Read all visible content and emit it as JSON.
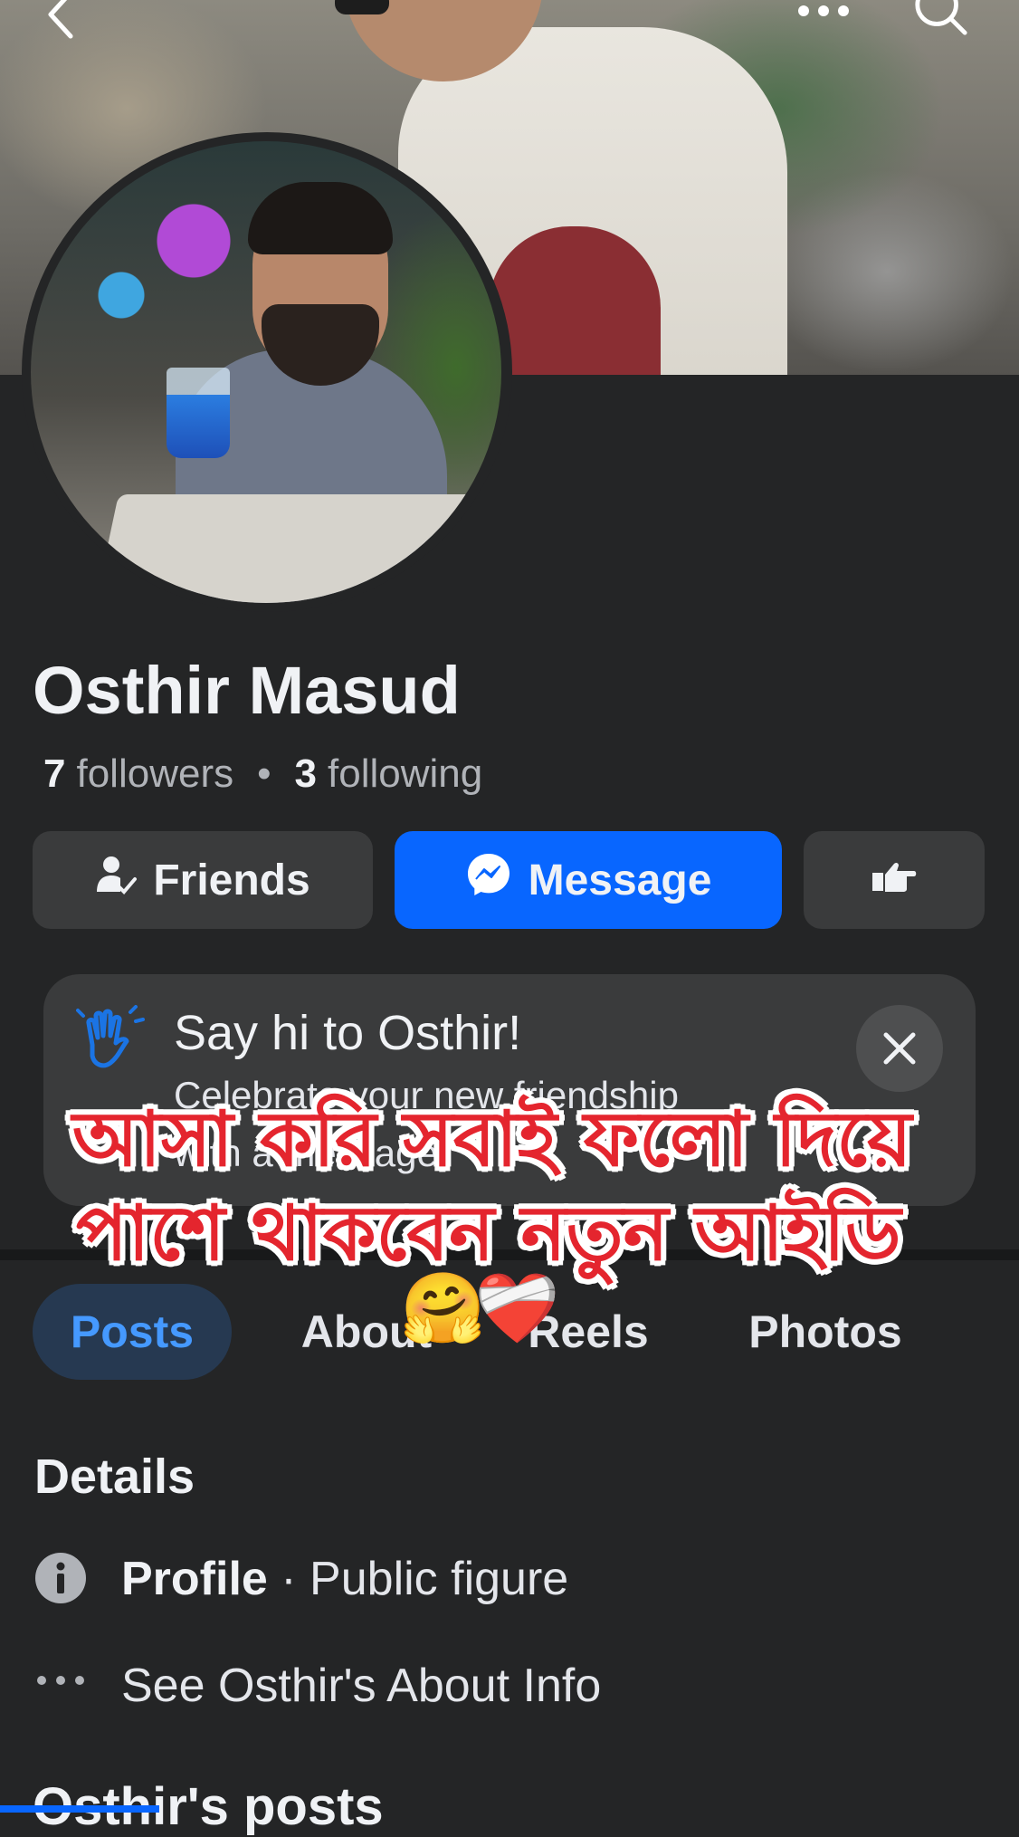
{
  "profile": {
    "name": "Osthir Masud",
    "followers_count": "7",
    "followers_label": "followers",
    "following_count": "3",
    "following_label": "following"
  },
  "actions": {
    "friends_label": "Friends",
    "message_label": "Message"
  },
  "say_hi_card": {
    "title": "Say hi to Osthir!",
    "subtitle_line1": "Celebrate your new friendship",
    "subtitle_line2": "with a message."
  },
  "overlay_caption": {
    "line1": "আসা করি সবাই ফলো দিয়ে",
    "line2": "পাশে থাকবেন  নতুন আইডি",
    "emoji_1": "🤗",
    "emoji_2": "❤️‍🩹"
  },
  "tabs": [
    {
      "label": "Posts",
      "active": true
    },
    {
      "label": "About",
      "active": false
    },
    {
      "label": "Reels",
      "active": false
    },
    {
      "label": "Photos",
      "active": false
    }
  ],
  "details": {
    "title": "Details",
    "profile_label": "Profile",
    "profile_value": " · Public figure",
    "about_link": "See Osthir's About Info"
  },
  "posts_section": {
    "title": "Osthir's posts"
  },
  "colors": {
    "background": "#242526",
    "accent": "#0866ff",
    "overlay_text": "#e4252e"
  },
  "icons": [
    "back-icon",
    "more-icon",
    "search-icon",
    "friends-icon",
    "messenger-icon",
    "poke-icon",
    "wave-icon",
    "close-icon",
    "info-icon",
    "more-horizontal-icon"
  ]
}
